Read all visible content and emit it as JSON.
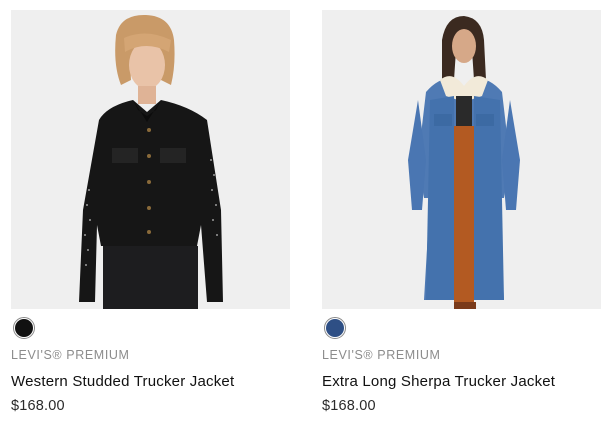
{
  "products": [
    {
      "brand": "LEVI'S® PREMIUM",
      "name": "Western Studded Trucker Jacket",
      "price": "$168.00",
      "swatch_color": "#111111",
      "image_icon": "black-studded-jacket-photo"
    },
    {
      "brand": "LEVI'S® PREMIUM",
      "name": "Extra Long Sherpa Trucker Jacket",
      "price": "$168.00",
      "swatch_color": "#2e4f85",
      "image_icon": "long-denim-sherpa-jacket-photo"
    }
  ],
  "colors": {
    "photo_background": "#efefef",
    "brand_text": "#8c8c8c",
    "name_text": "#111111"
  }
}
